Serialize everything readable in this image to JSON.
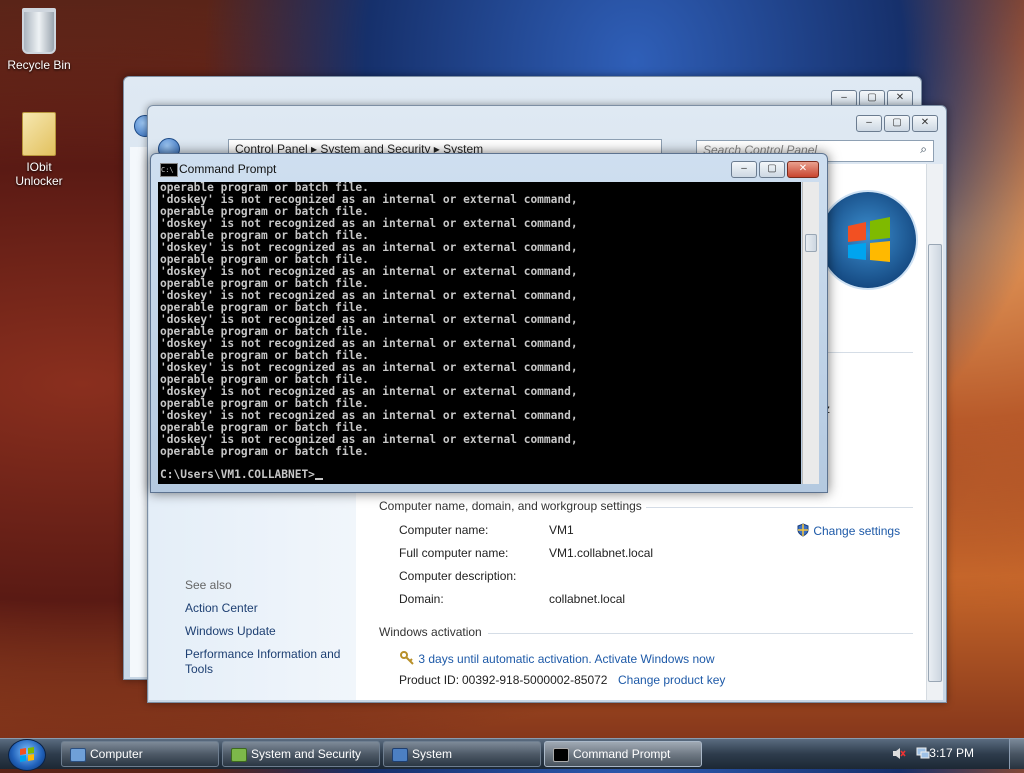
{
  "desktop": {
    "icons": [
      {
        "label": "Recycle Bin"
      },
      {
        "label": "IObit Unlocker"
      }
    ]
  },
  "control_panel": {
    "breadcrumb": [
      "Control Panel",
      "System and Security",
      "System"
    ],
    "search_placeholder": "Search Control Panel",
    "see_also": {
      "heading": "See also",
      "links": [
        "Action Center",
        "Windows Update",
        "Performance Information and Tools"
      ]
    },
    "computer_section": {
      "heading": "Computer name, domain, and workgroup settings",
      "change_settings": "Change settings",
      "rows": [
        {
          "label": "Computer name:",
          "value": "VM1"
        },
        {
          "label": "Full computer name:",
          "value": "VM1.collabnet.local"
        },
        {
          "label": "Computer description:",
          "value": ""
        },
        {
          "label": "Domain:",
          "value": "collabnet.local"
        }
      ]
    },
    "activation": {
      "heading": "Windows activation",
      "message": "3 days until automatic activation. Activate Windows now",
      "product_id_label": "Product ID:",
      "product_id": "00392-918-5000002-85072",
      "change_key": "Change product key"
    },
    "partial_text": "z"
  },
  "cmd": {
    "title": "Command Prompt",
    "icon_text": "C:\\",
    "lines": [
      "operable program or batch file.",
      "'doskey' is not recognized as an internal or external command,",
      "operable program or batch file.",
      "'doskey' is not recognized as an internal or external command,",
      "operable program or batch file.",
      "'doskey' is not recognized as an internal or external command,",
      "operable program or batch file.",
      "'doskey' is not recognized as an internal or external command,",
      "operable program or batch file.",
      "'doskey' is not recognized as an internal or external command,",
      "operable program or batch file.",
      "'doskey' is not recognized as an internal or external command,",
      "operable program or batch file.",
      "'doskey' is not recognized as an internal or external command,",
      "operable program or batch file.",
      "'doskey' is not recognized as an internal or external command,",
      "operable program or batch file.",
      "'doskey' is not recognized as an internal or external command,",
      "operable program or batch file.",
      "'doskey' is not recognized as an internal or external command,",
      "operable program or batch file.",
      "'doskey' is not recognized as an internal or external command,",
      "operable program or batch file."
    ],
    "prompt": "C:\\Users\\VM1.COLLABNET>"
  },
  "taskbar": {
    "items": [
      {
        "label": "Computer"
      },
      {
        "label": "System and Security"
      },
      {
        "label": "System"
      },
      {
        "label": "Command Prompt"
      }
    ],
    "clock": "3:17 PM"
  },
  "window_controls": {
    "minimize": "–",
    "maximize": "▢",
    "close": "✕"
  }
}
